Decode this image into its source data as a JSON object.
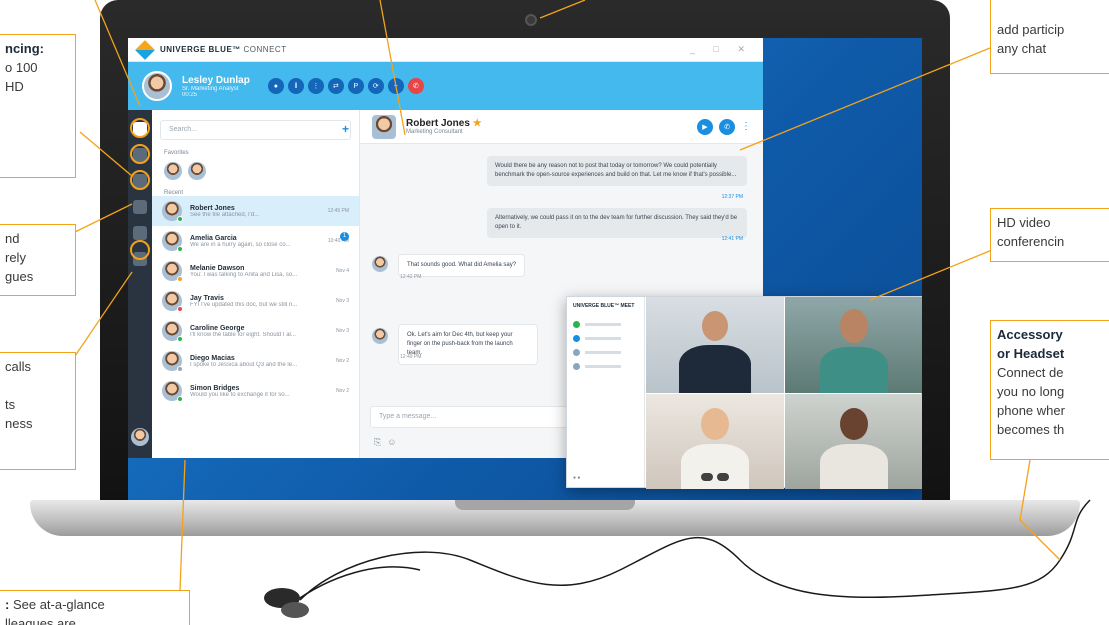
{
  "app": {
    "brand": "UNIVERGE BLUE",
    "brand_tm": "™",
    "brand_product": "CONNECT",
    "window_controls": "_ □ ✕"
  },
  "call": {
    "caller_name": "Lesley Dunlap",
    "caller_title": "Sr. Marketing Analyst",
    "duration": "00:25",
    "buttons": [
      "mic",
      "pause",
      "keypad",
      "transfer",
      "park",
      "merge",
      "add",
      "end"
    ]
  },
  "contacts": {
    "search_placeholder": "Search...",
    "favorites_label": "Favorites",
    "recent_label": "Recent",
    "items": [
      {
        "name": "Robert Jones",
        "preview": "See the file attached, I'd...",
        "time": "12:45 PM",
        "presence": "#2bb24c"
      },
      {
        "name": "Amelia Garcia",
        "preview": "We are in a hurry again, so close co...",
        "time": "10:40 AM",
        "presence": "#2bb24c",
        "badge": "1"
      },
      {
        "name": "Melanie Dawson",
        "preview": "You: I was talking to Anita and Lisa, so...",
        "time": "Nov 4",
        "presence": "#f4a21b"
      },
      {
        "name": "Jay Travis",
        "preview": "FYI I've updated this doc, but we still n...",
        "time": "Nov 3",
        "presence": "#e64646"
      },
      {
        "name": "Caroline George",
        "preview": "I'll know the table for eight. Should I al...",
        "time": "Nov 3",
        "presence": "#2bb24c"
      },
      {
        "name": "Diego Macias",
        "preview": "I spoke to Jessica about Q3 and the le...",
        "time": "Nov 2",
        "presence": "#9aa5b0"
      },
      {
        "name": "Simon Bridges",
        "preview": "Would you like to exchange it for so...",
        "time": "Nov 2",
        "presence": "#2bb24c"
      }
    ]
  },
  "chat": {
    "name": "Robert Jones",
    "star": "★",
    "role": "Marketing Consultant",
    "messages": [
      {
        "text": "Would there be any reason not to post that today or tomorrow? We could potentially benchmark the open-source experiences and build on that. Let me know if that's possible...",
        "time": "12:37 PM"
      },
      {
        "text": "Alternatively, we could pass it on to the dev team for further discussion. They said they'd be open to it.",
        "time": "12:41 PM"
      },
      {
        "text": "That sounds good. What did Amelia say?",
        "time": "12:42 PM"
      },
      {
        "text": "Ok. Let's aim for Dec 4th, but keep your finger on the push-back from the launch team.",
        "time": "12:49 PM"
      }
    ],
    "composer_placeholder": "Type a message..."
  },
  "video": {
    "brand": "UNIVERGE BLUE™ MEET"
  },
  "callouts": {
    "conferencing": {
      "title": "ncing:",
      "lines": [
        "o 100",
        "HD"
      ]
    },
    "files": {
      "lines": [
        "nd",
        "rely",
        "gues"
      ]
    },
    "calls": {
      "lines": [
        "calls",
        "",
        "ts",
        "ness"
      ]
    },
    "presence": {
      "title": ":",
      "lines": [
        " See at-a-glance",
        "lleagues are"
      ]
    },
    "add_participants": {
      "lines": [
        "add particip",
        "any chat"
      ]
    },
    "hd_video": {
      "lines": [
        "HD video",
        "conferencin"
      ]
    },
    "accessory": {
      "title": "Accessory",
      "title2": "or Headset",
      "lines": [
        "Connect de",
        "you no long",
        "phone wher",
        "becomes th"
      ]
    }
  },
  "colors": {
    "accent_orange": "#f4a21b",
    "brand_blue": "#1a8ee0",
    "callbar_blue": "#43b9ee",
    "rail_dark": "#293440",
    "end_call_red": "#e64646"
  }
}
